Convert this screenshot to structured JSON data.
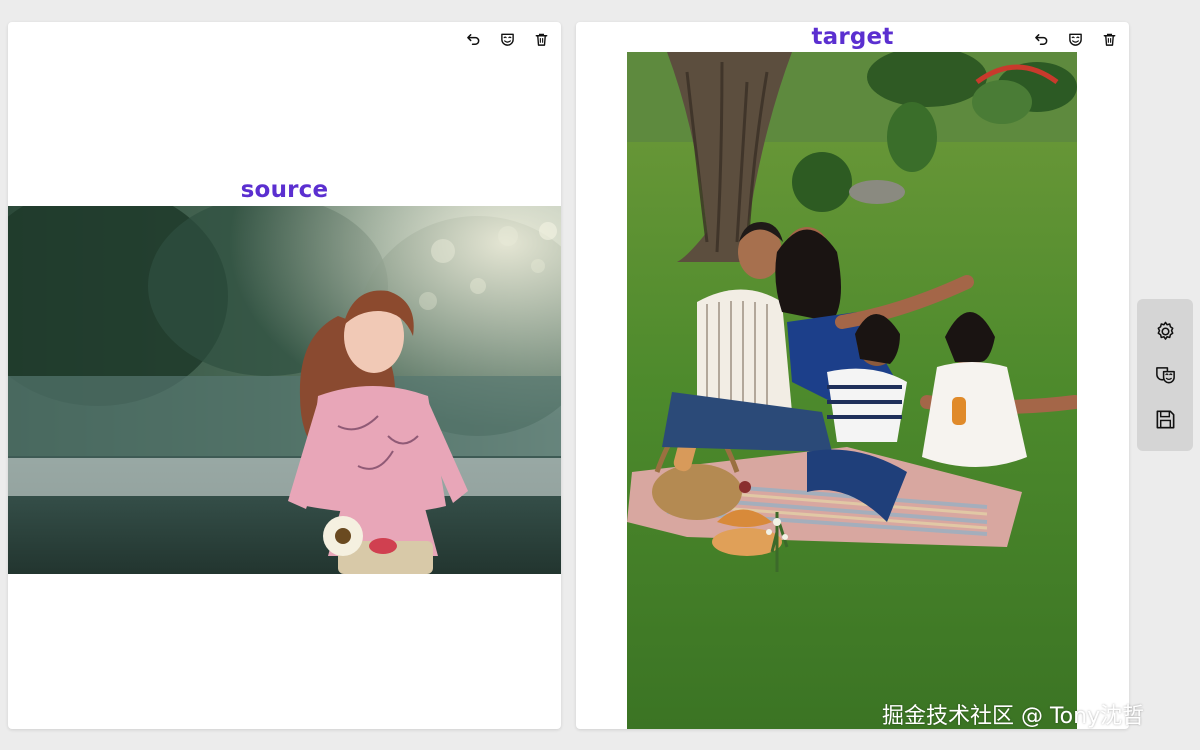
{
  "source_panel": {
    "label": "source",
    "toolbar": {
      "undo_icon": "undo-icon",
      "mask_icon": "theater-mask-icon",
      "delete_icon": "trash-icon"
    }
  },
  "target_panel": {
    "label": "target",
    "toolbar": {
      "undo_icon": "undo-icon",
      "mask_icon": "theater-mask-icon",
      "delete_icon": "trash-icon"
    }
  },
  "side_toolbar": {
    "items": [
      "gear-icon",
      "theater-masks-icon",
      "save-icon"
    ]
  },
  "watermark": "掘金技术社区 @ Tony沈哲",
  "colors": {
    "label": "#5b2fd0",
    "background": "#ececec",
    "panel": "#ffffff",
    "side_toolbar": "#d5d5d5"
  }
}
